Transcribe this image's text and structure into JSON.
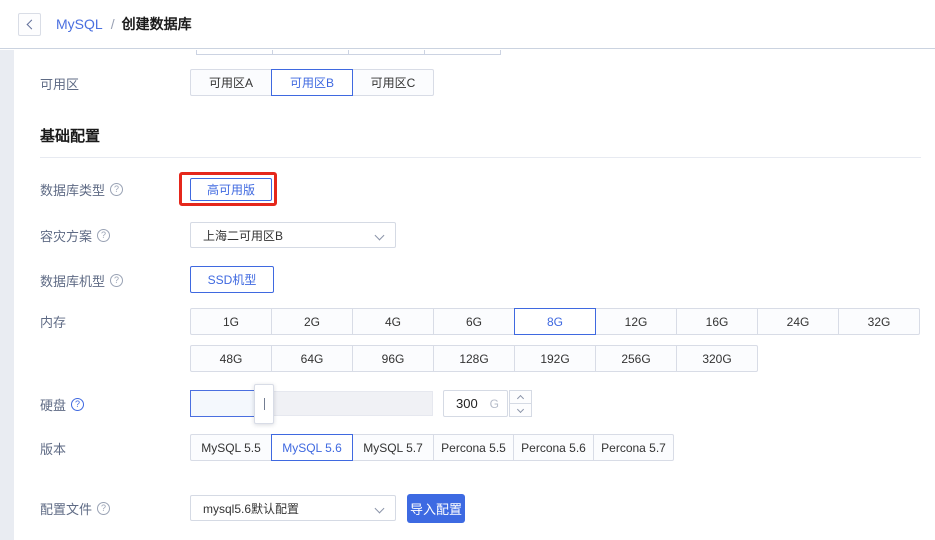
{
  "header": {
    "product": "MySQL",
    "separator": "/",
    "title": "创建数据库"
  },
  "zone": {
    "label": "可用区",
    "options": [
      "可用区A",
      "可用区B",
      "可用区C"
    ],
    "selected": "可用区B"
  },
  "section": {
    "title": "基础配置"
  },
  "db_type": {
    "label": "数据库类型",
    "help_icon": "?",
    "selected": "高可用版"
  },
  "dr_plan": {
    "label": "容灾方案",
    "help_icon": "?",
    "value": "上海二可用区B"
  },
  "machine_type": {
    "label": "数据库机型",
    "help_icon": "?",
    "selected": "SSD机型"
  },
  "memory": {
    "label": "内存",
    "options_row1": [
      "1G",
      "2G",
      "4G",
      "6G",
      "8G",
      "12G",
      "16G",
      "24G",
      "32G"
    ],
    "options_row2": [
      "48G",
      "64G",
      "96G",
      "128G",
      "192G",
      "256G",
      "320G"
    ],
    "selected": "8G"
  },
  "disk": {
    "label": "硬盘",
    "help_icon": "?",
    "value": "300",
    "unit": "G"
  },
  "version": {
    "label": "版本",
    "options": [
      "MySQL 5.5",
      "MySQL 5.6",
      "MySQL 5.7",
      "Percona 5.5",
      "Percona 5.6",
      "Percona 5.7"
    ],
    "selected": "MySQL 5.6"
  },
  "config_file": {
    "label": "配置文件",
    "help_icon": "?",
    "value": "mysql5.6默认配置",
    "import_button": "导入配置"
  },
  "colors": {
    "accent": "#3f69e0",
    "primary_button_bg": "#3d6ae2",
    "highlight_red": "#e5271b"
  }
}
